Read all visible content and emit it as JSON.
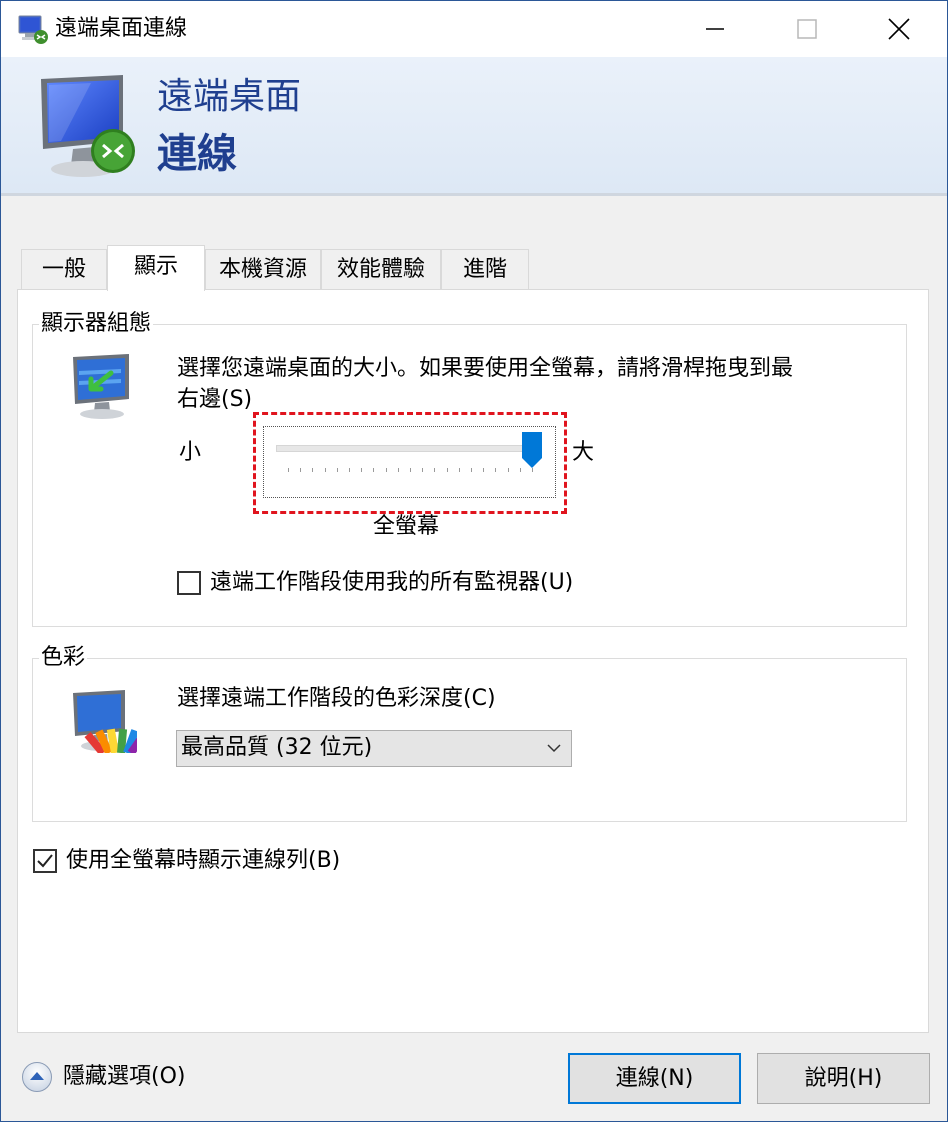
{
  "window": {
    "title": "遠端桌面連線",
    "controls": {
      "minimize_icon": "minimize-icon",
      "maximize_icon": "maximize-icon",
      "close_icon": "close-icon"
    }
  },
  "banner": {
    "line1": "遠端桌面",
    "line2": "連線",
    "icon": "remote-desktop-monitor-icon"
  },
  "tabs": [
    {
      "label": "一般",
      "active": false
    },
    {
      "label": "顯示",
      "active": true
    },
    {
      "label": "本機資源",
      "active": false
    },
    {
      "label": "效能體驗",
      "active": false
    },
    {
      "label": "進階",
      "active": false
    }
  ],
  "display_config": {
    "group_title": "顯示器組態",
    "description_line1": "選擇您遠端桌面的大小。如果要使用全螢幕，請將滑桿拖曳到最",
    "description_line2": "右邊(S)",
    "slider": {
      "min_label": "小",
      "max_label": "大",
      "value_label": "全螢幕",
      "position_fraction": 1.0,
      "tick_count": 21
    },
    "all_monitors_label": "遠端工作階段使用我的所有監視器(U)",
    "all_monitors_checked": false
  },
  "color": {
    "group_title": "色彩",
    "description": "選擇遠端工作階段的色彩深度(C)",
    "selected": "最高品質 (32 位元)"
  },
  "connection_bar": {
    "label": "使用全螢幕時顯示連線列(B)",
    "checked": true
  },
  "footer": {
    "hide_options_label": "隱藏選項(O)",
    "connect_label": "連線(N)",
    "help_label": "說明(H)"
  },
  "colors": {
    "banner_text": "#1f3f8f",
    "accent": "#0078d7",
    "highlight_dashed": "#e0141e"
  }
}
